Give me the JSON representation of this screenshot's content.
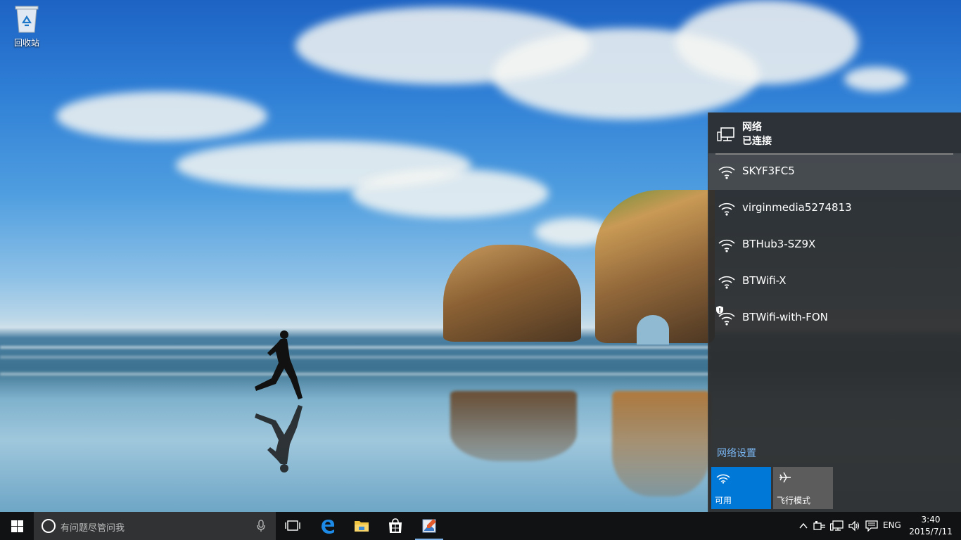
{
  "desktop": {
    "recycle_bin_label": "回收站"
  },
  "network_flyout": {
    "title": "网络",
    "status": "已连接",
    "networks": [
      {
        "ssid": "SKYF3FC5",
        "selected": true,
        "secured_warning": false
      },
      {
        "ssid": "virginmedia5274813",
        "selected": false,
        "secured_warning": false
      },
      {
        "ssid": "BTHub3-SZ9X",
        "selected": false,
        "secured_warning": false
      },
      {
        "ssid": "BTWifi-X",
        "selected": false,
        "secured_warning": false
      },
      {
        "ssid": "BTWifi-with-FON",
        "selected": false,
        "secured_warning": true
      }
    ],
    "settings_link": "网络设置",
    "quick_actions": {
      "wifi_label": "可用",
      "airplane_label": "飞行模式"
    }
  },
  "taskbar": {
    "search_placeholder": "有问题尽管问我",
    "language": "ENG",
    "clock": {
      "time": "3:40",
      "date": "2015/7/11"
    }
  },
  "colors": {
    "accent": "#0078d7",
    "link": "#7ab8f5",
    "flyout_bg": "#2b2b2b",
    "taskbar_bg": "#101213"
  },
  "icons": {
    "start": "windows-logo-icon",
    "task_view": "task-view-icon",
    "edge": "edge-icon",
    "explorer": "file-explorer-icon",
    "store": "store-icon",
    "paint": "paint-app-icon"
  }
}
